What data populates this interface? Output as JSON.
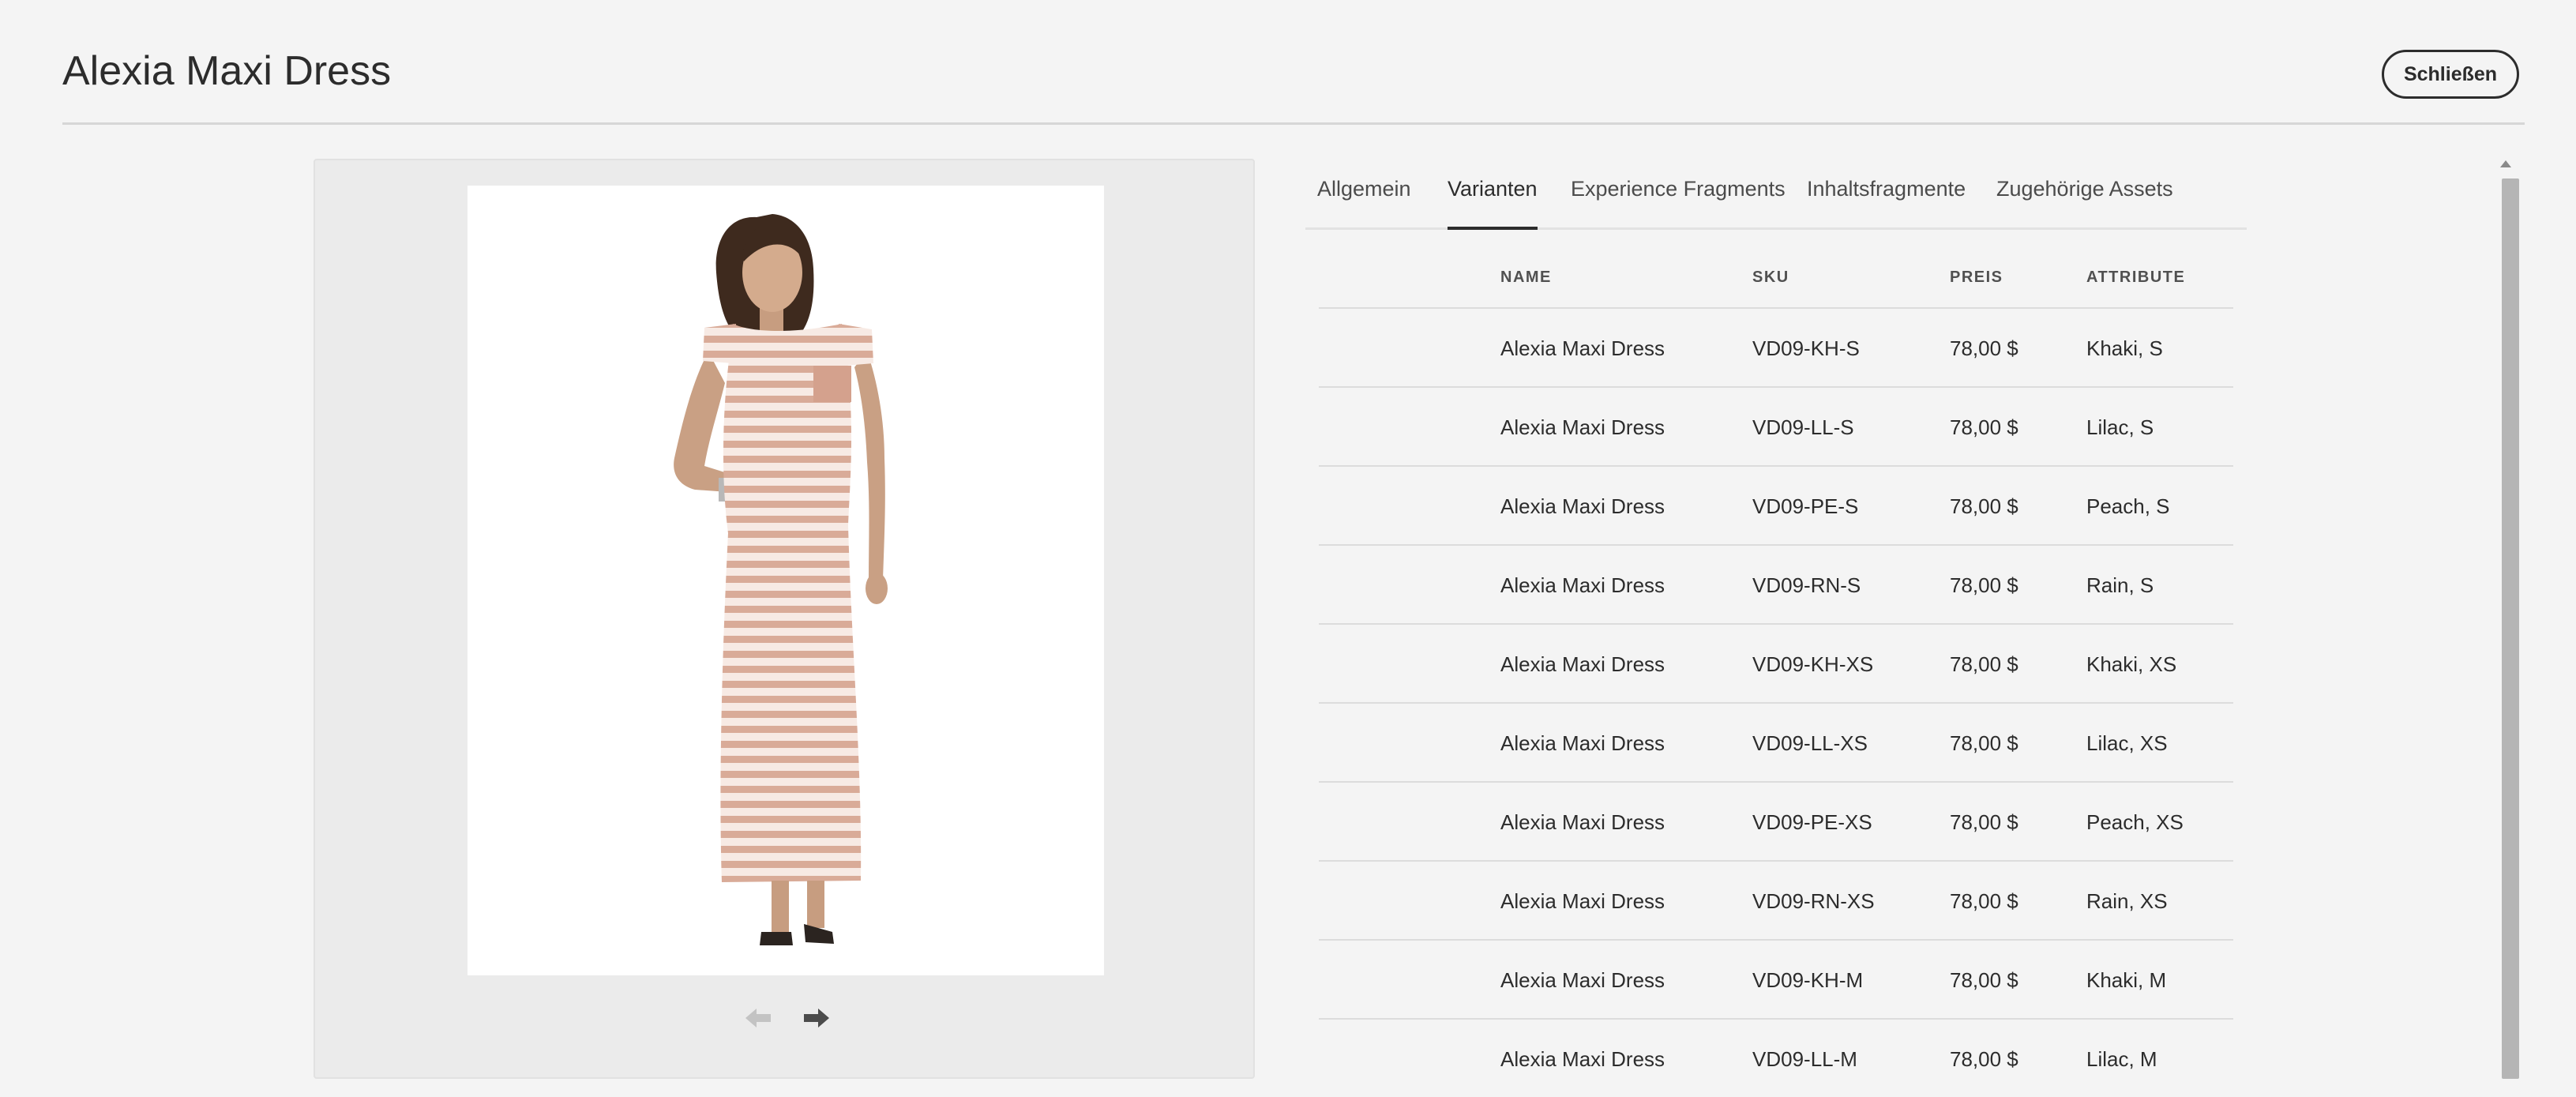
{
  "header": {
    "title": "Alexia Maxi Dress",
    "close_label": "Schließen"
  },
  "tabs": [
    {
      "label": "Allgemein",
      "active": false
    },
    {
      "label": "Varianten",
      "active": true
    },
    {
      "label": "Experience Fragments",
      "active": false
    },
    {
      "label": "Inhaltsfragmente",
      "active": false
    },
    {
      "label": "Zugehörige Assets",
      "active": false
    }
  ],
  "table": {
    "headers": {
      "name": "NAME",
      "sku": "SKU",
      "price": "PREIS",
      "attributes": "ATTRIBUTE"
    },
    "rows": [
      {
        "name": "Alexia Maxi Dress",
        "sku": "VD09-KH-S",
        "price": "78,00 $",
        "attributes": "Khaki, S"
      },
      {
        "name": "Alexia Maxi Dress",
        "sku": "VD09-LL-S",
        "price": "78,00 $",
        "attributes": "Lilac, S"
      },
      {
        "name": "Alexia Maxi Dress",
        "sku": "VD09-PE-S",
        "price": "78,00 $",
        "attributes": "Peach, S"
      },
      {
        "name": "Alexia Maxi Dress",
        "sku": "VD09-RN-S",
        "price": "78,00 $",
        "attributes": "Rain, S"
      },
      {
        "name": "Alexia Maxi Dress",
        "sku": "VD09-KH-XS",
        "price": "78,00 $",
        "attributes": "Khaki, XS"
      },
      {
        "name": "Alexia Maxi Dress",
        "sku": "VD09-LL-XS",
        "price": "78,00 $",
        "attributes": "Lilac, XS"
      },
      {
        "name": "Alexia Maxi Dress",
        "sku": "VD09-PE-XS",
        "price": "78,00 $",
        "attributes": "Peach, XS"
      },
      {
        "name": "Alexia Maxi Dress",
        "sku": "VD09-RN-XS",
        "price": "78,00 $",
        "attributes": "Rain, XS"
      },
      {
        "name": "Alexia Maxi Dress",
        "sku": "VD09-KH-M",
        "price": "78,00 $",
        "attributes": "Khaki, M"
      },
      {
        "name": "Alexia Maxi Dress",
        "sku": "VD09-LL-M",
        "price": "78,00 $",
        "attributes": "Lilac, M"
      }
    ]
  },
  "image_nav": {
    "prev_icon": "arrow-left-icon",
    "next_icon": "arrow-right-icon",
    "prev_enabled": false,
    "next_enabled": true
  },
  "colors": {
    "background": "#f4f4f4",
    "text": "#2c2c2c",
    "dress_stripe": "#d9ab98",
    "scrollbar": "#b5b5b5"
  }
}
